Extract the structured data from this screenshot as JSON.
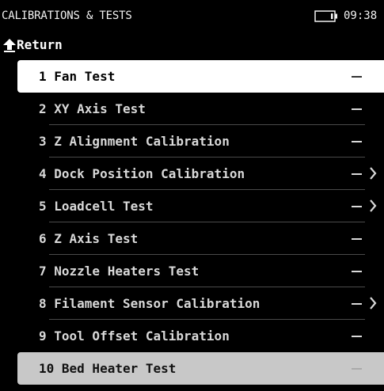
{
  "header": {
    "title": "CALIBRATIONS & TESTS",
    "clock": "09:38",
    "battery_icon": "battery-icon"
  },
  "return": {
    "icon": "return-arrow-icon",
    "label": "Return"
  },
  "menu": {
    "items": [
      {
        "label": "1 Fan Test",
        "has_submenu": false,
        "state": "selected"
      },
      {
        "label": "2 XY Axis Test",
        "has_submenu": false,
        "state": "normal"
      },
      {
        "label": "3 Z Alignment Calibration",
        "has_submenu": false,
        "state": "normal"
      },
      {
        "label": "4 Dock Position Calibration",
        "has_submenu": true,
        "state": "normal"
      },
      {
        "label": "5 Loadcell Test",
        "has_submenu": true,
        "state": "normal"
      },
      {
        "label": "6 Z Axis Test",
        "has_submenu": false,
        "state": "normal"
      },
      {
        "label": "7 Nozzle Heaters Test",
        "has_submenu": false,
        "state": "normal"
      },
      {
        "label": "8 Filament Sensor Calibration",
        "has_submenu": true,
        "state": "normal"
      },
      {
        "label": "9 Tool Offset Calibration",
        "has_submenu": false,
        "state": "normal"
      },
      {
        "label": "10 Bed Heater Test",
        "has_submenu": false,
        "state": "disabled"
      }
    ],
    "status_icon": "dash-icon",
    "submenu_icon": "chevron-right-icon"
  },
  "colors": {
    "background": "#000000",
    "text": "#d9d9d9",
    "selected_bg": "#ffffff",
    "disabled_bg": "#c8c8c8",
    "divider": "#4a4a4a"
  }
}
